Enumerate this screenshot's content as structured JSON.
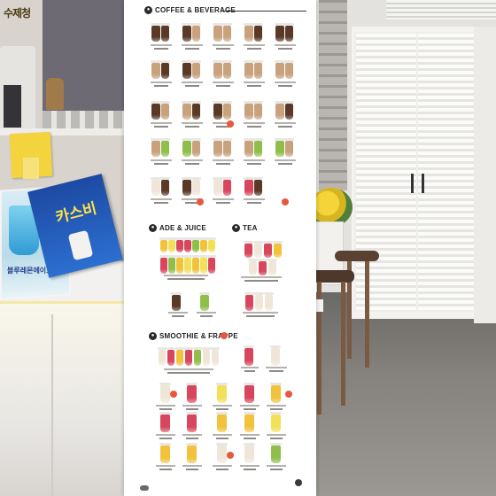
{
  "banner": {
    "sections": [
      {
        "title": "COFFEE & BEVERAGE"
      },
      {
        "title": "ADE & JUICE"
      },
      {
        "title": "TEA"
      },
      {
        "title": "SMOOTHIE & FRAPPE"
      }
    ]
  },
  "counter": {
    "sticky_note": "수제청",
    "poster_blue_text": "카스비",
    "poster_light_text": "블루레몬에이드"
  },
  "colors": {
    "banner_bg": "#ffffff",
    "heading": "#222222",
    "badge": "#e8583f",
    "coffee": "#5a3a26",
    "latte": "#c7a27d",
    "matcha": "#8fbf4a",
    "berry": "#d8465d",
    "mango": "#f2c23c",
    "lemon": "#f1e05a",
    "milk": "#efe6d8"
  },
  "icons": [
    "cup-icon",
    "hot-badge-icon"
  ]
}
